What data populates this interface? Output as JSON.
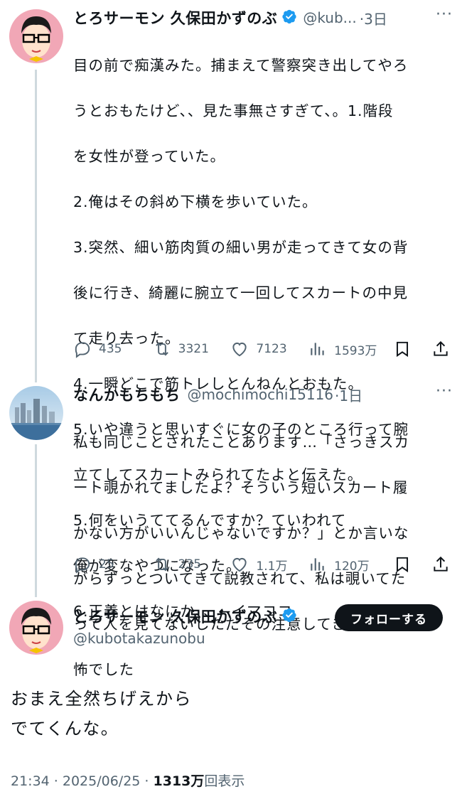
{
  "tweet1": {
    "name": "とろサーモン 久保田かずのぶ",
    "handle": "@kub...",
    "time": "·3日",
    "lines": [
      "目の前で痴漢みた。捕まえて警察突き出してやろ",
      "うとおもたけど、、見た事無さすぎて、。1.階段",
      "を女性が登っていた。",
      "2.俺はその斜め下横を歩いていた。",
      "3.突然、細い筋肉質の細い男が走ってきて女の背",
      "後に行き、綺麗に腕立て一回してスカートの中見",
      "て走り去った。",
      "4.一瞬どこで筋トレしとんねんとおもた。",
      "5.いや違うと思いすぐに女の子のところ行って腕",
      "立てしてスカートみられてたよと伝えた。",
      "5.何をいうててるんですか？ていわれて",
      "俺が変なやつになった。",
      "6.正義とはなにか、、←イマココ"
    ],
    "replies": "435",
    "reposts": "3321",
    "likes": "7123",
    "views": "1593万"
  },
  "tweet2": {
    "name": "なんかもちもち",
    "handle": "@mochimochi15116",
    "time": "·1日",
    "lines": [
      "私も同じことされたことあります…「さっきスカ",
      "ート覗かれてましたよ？そういう短いスカート履",
      "かない方がいいんじゃないですか？」とか言いな",
      "がらずっとついてきて説教されて、私は覗いてた",
      "って人を見てないしただその注意してきた人が恐",
      "怖でした"
    ],
    "replies": "25",
    "reposts": "235",
    "likes": "1.1万",
    "views": "120万"
  },
  "main": {
    "name": "とろサーモン 久保田かずのぶ",
    "handle": "@kubotakazunobu",
    "follow_label": "フォローする",
    "line1": "おまえ全然ちげえから",
    "line2": "でてくんな。",
    "time": "21:34 · 2025/06/25 · ",
    "views_num": "1313万",
    "views_label": "回表示"
  },
  "icons": [
    "more-icon",
    "verified-icon",
    "reply-icon",
    "repost-icon",
    "like-icon",
    "views-icon",
    "bookmark-icon",
    "share-icon"
  ],
  "colors": {
    "verified": "#1d9bf0",
    "text": "#0f1419",
    "muted": "#536471",
    "thread": "#cfd9de",
    "button": "#0f1419"
  }
}
